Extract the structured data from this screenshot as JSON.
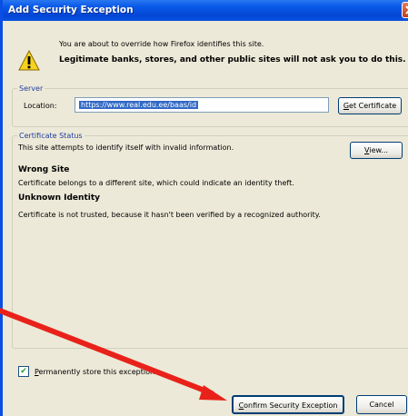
{
  "window": {
    "title": "Add Security Exception"
  },
  "message": {
    "line1": "You are about to override how Firefox identifies this site.",
    "line2": "Legitimate banks, stores, and other public sites will not ask you to do this."
  },
  "server": {
    "legend": "Server",
    "location_label": "Location:",
    "location_value": "https://www.real.edu.ee/baas/id",
    "get_certificate": {
      "accel": "G",
      "rest": "et Certificate"
    }
  },
  "status": {
    "legend": "Certificate Status",
    "message": "This site attempts to identify itself with invalid information.",
    "view": {
      "accel": "V",
      "rest": "iew..."
    },
    "wrong_site_title": "Wrong Site",
    "wrong_site_desc": "Certificate belongs to a different site, which could indicate an identity theft.",
    "unknown_identity_title": "Unknown Identity",
    "unknown_identity_desc": "Certificate is not trusted, because it hasn't been verified by a recognized authority."
  },
  "permanent": {
    "accel": "P",
    "rest": "ermanently store this exception",
    "checked": true
  },
  "buttons": {
    "confirm": {
      "accel": "C",
      "rest": "onfirm Security Exception"
    },
    "cancel": "Cancel"
  },
  "colors": {
    "titlebar": "#0a5ae8",
    "arrow": "#e8221a",
    "dialog_bg": "#ece9d8"
  }
}
